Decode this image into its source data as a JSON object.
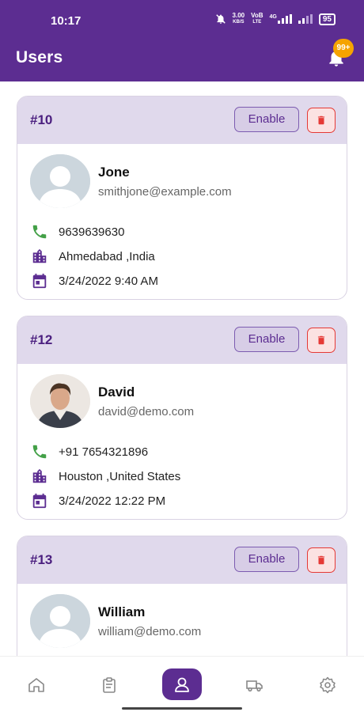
{
  "status_bar": {
    "time": "10:17",
    "net_speed_top": "3.00",
    "net_speed_bottom": "KB/S",
    "volte_top": "VoB",
    "volte_bottom": "LTE",
    "network": "4G",
    "battery": "95"
  },
  "header": {
    "title": "Users",
    "notification_badge": "99+"
  },
  "users": [
    {
      "id": "#10",
      "enable_label": "Enable",
      "name": "Jone",
      "email": "smithjone@example.com",
      "phone": "9639639630",
      "location": "Ahmedabad ,India",
      "date": "3/24/2022 9:40 AM",
      "avatar": "placeholder"
    },
    {
      "id": "#12",
      "enable_label": "Enable",
      "name": "David",
      "email": "david@demo.com",
      "phone": "+91 7654321896",
      "location": "Houston ,United States",
      "date": "3/24/2022 12:22 PM",
      "avatar": "photo"
    },
    {
      "id": "#13",
      "enable_label": "Enable",
      "name": "William",
      "email": "william@demo.com",
      "avatar": "placeholder"
    }
  ],
  "colors": {
    "primary": "#5c2d91",
    "card_header": "#e0d9ec",
    "delete": "#e53935",
    "phone_icon": "#43a047",
    "badge": "#f5a300"
  },
  "bottom_nav": [
    "home-icon",
    "clipboard-icon",
    "user-icon",
    "truck-icon",
    "settings-icon"
  ]
}
